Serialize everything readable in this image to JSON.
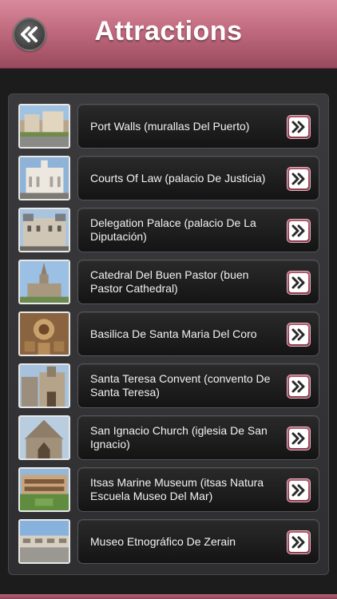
{
  "header": {
    "title": "Attractions",
    "back_icon": "double-chevron-left-icon"
  },
  "colors": {
    "header": "#c06a7e",
    "background": "#1c1c1d",
    "accent": "#9a4a5e"
  },
  "items": [
    {
      "label": "Port Walls (murallas Del Puerto)",
      "action_icon": "double-chevron-right-icon"
    },
    {
      "label": "Courts Of Law (palacio De Justicia)",
      "action_icon": "double-chevron-right-icon"
    },
    {
      "label": "Delegation Palace (palacio De La Diputación)",
      "action_icon": "double-chevron-right-icon"
    },
    {
      "label": "Catedral Del Buen Pastor (buen Pastor Cathedral)",
      "action_icon": "double-chevron-right-icon"
    },
    {
      "label": "Basilica De Santa Maria Del Coro",
      "action_icon": "double-chevron-right-icon"
    },
    {
      "label": "Santa Teresa Convent (convento De Santa Teresa)",
      "action_icon": "double-chevron-right-icon"
    },
    {
      "label": "San Ignacio Church (iglesia De San Ignacio)",
      "action_icon": "double-chevron-right-icon"
    },
    {
      "label": "Itsas Marine Museum (itsas Natura Escuela Museo Del Mar)",
      "action_icon": "double-chevron-right-icon"
    },
    {
      "label": "Museo Etnográfico De Zerain",
      "action_icon": "double-chevron-right-icon"
    }
  ]
}
